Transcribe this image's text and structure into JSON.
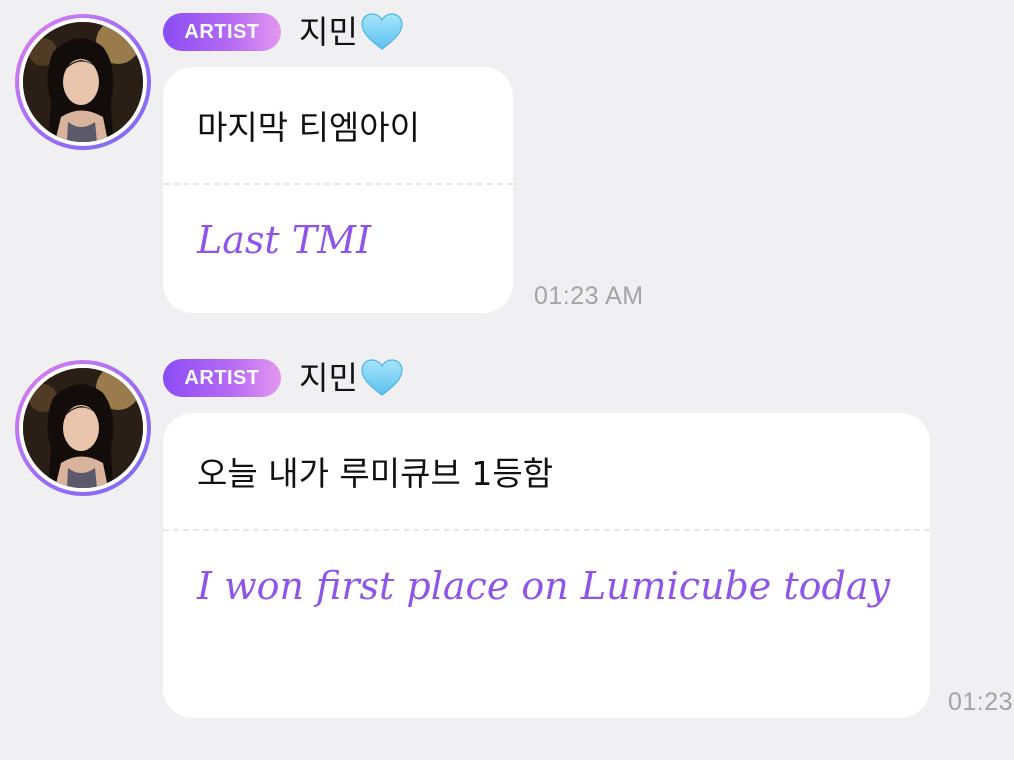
{
  "messages": [
    {
      "badge": "ARTIST",
      "sender": "지민",
      "heart_icon": "light-blue-heart-icon",
      "original": "마지막 티엠아이",
      "translation": "Last TMI",
      "time": "01:23 AM"
    },
    {
      "badge": "ARTIST",
      "sender": "지민",
      "heart_icon": "light-blue-heart-icon",
      "original": "오늘 내가 루미큐브 1등함",
      "translation": "I won first place on Lumicube today",
      "time": "01:23"
    }
  ],
  "colors": {
    "background": "#f0f0f2",
    "translation_text": "#8f55e8",
    "badge_gradient_start": "#8a4cf5",
    "badge_gradient_end": "#e397f0",
    "heart": "#7fd2f5",
    "timestamp": "#a3a3a8"
  }
}
